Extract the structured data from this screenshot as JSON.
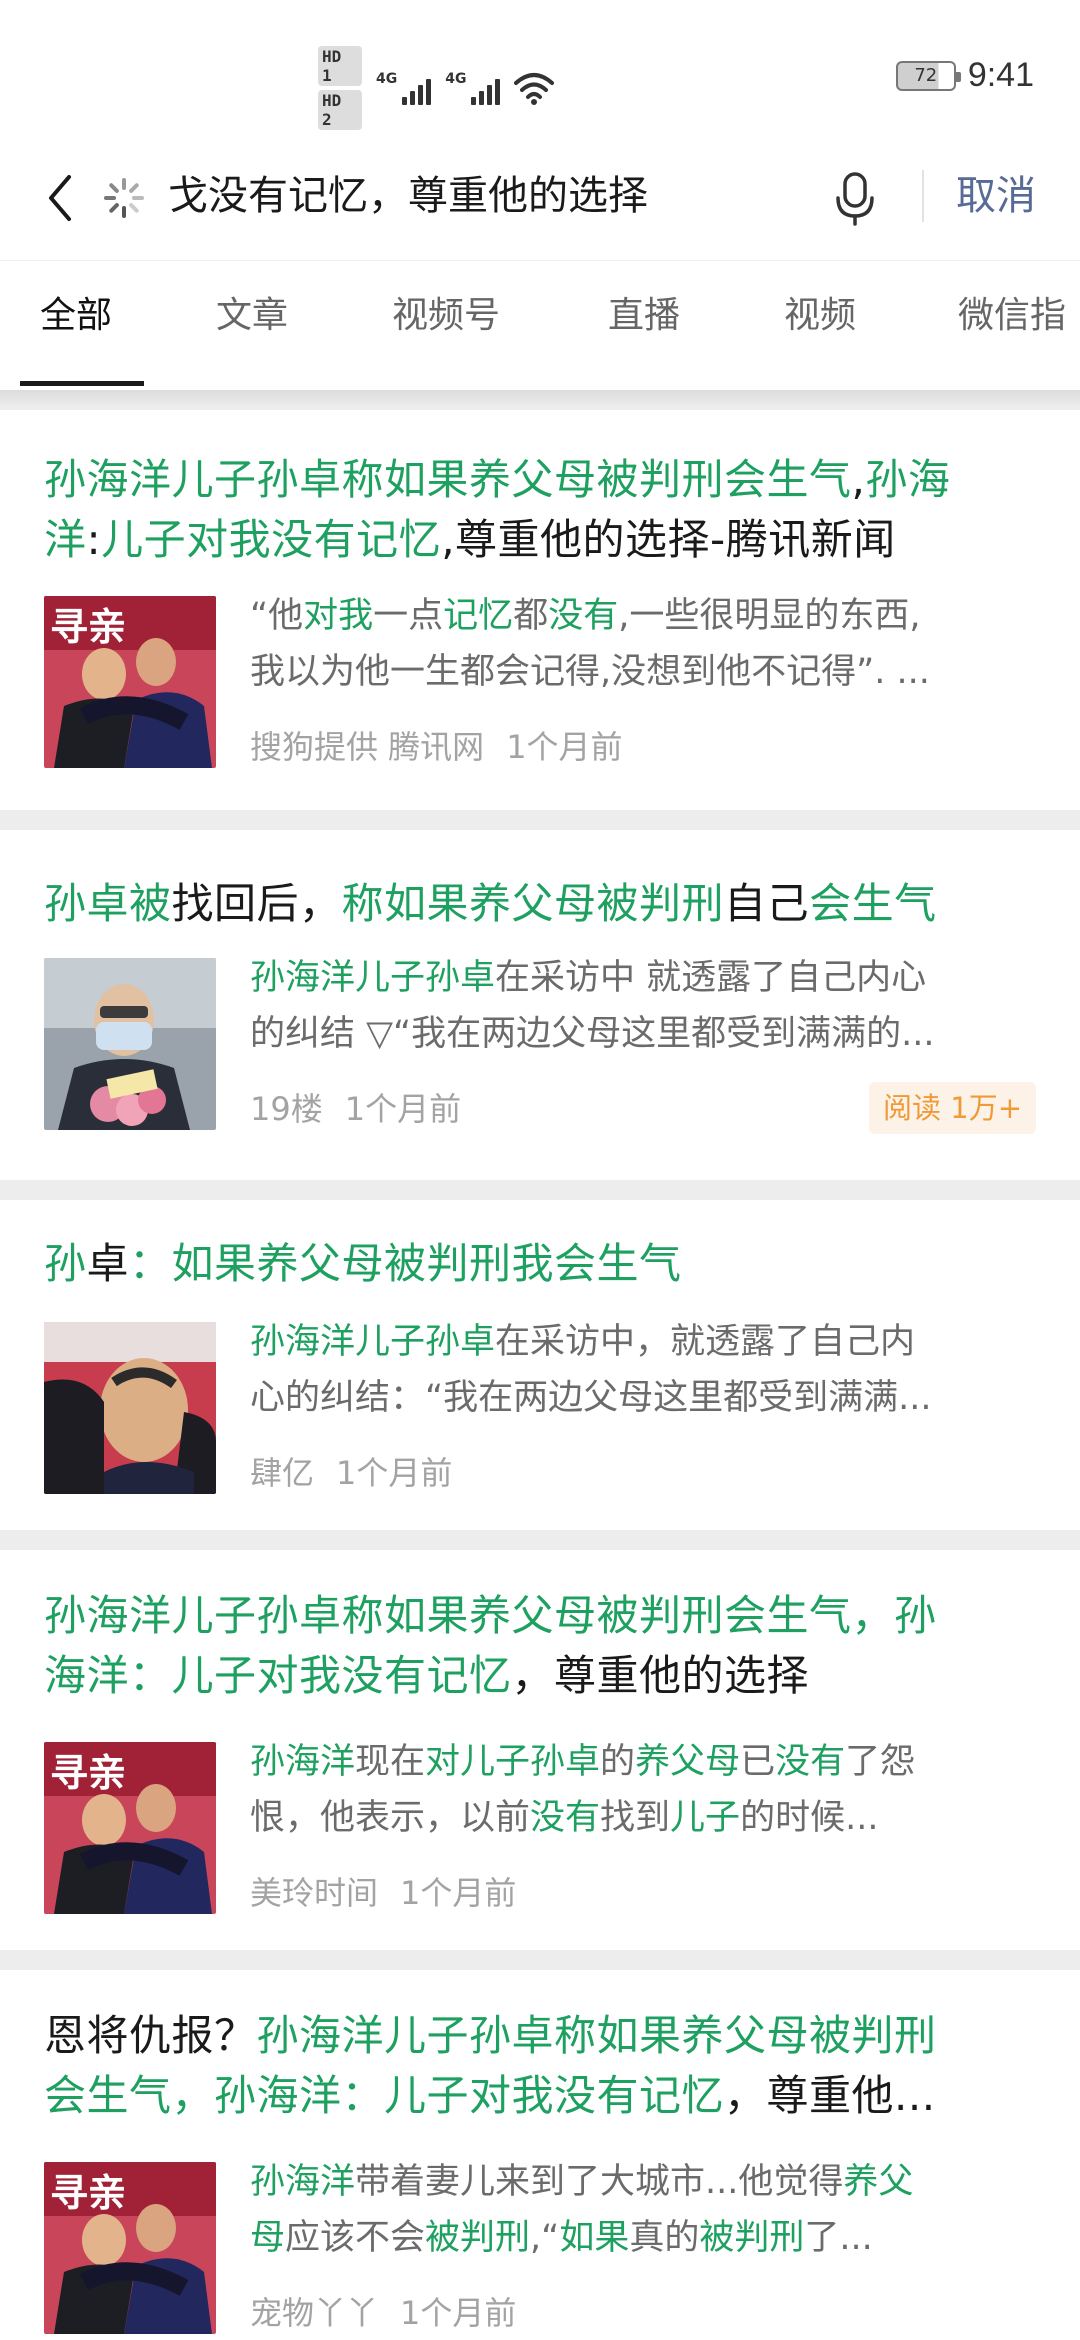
{
  "status_bar": {
    "sim1": "HD 1",
    "sim2": "HD 2",
    "net1": "4G",
    "net2": "4G",
    "battery": "72",
    "time": "9:41"
  },
  "search": {
    "query": "戈没有记忆，尊重他的选择",
    "cancel_label": "取消"
  },
  "tabs": [
    "全部",
    "文章",
    "视频号",
    "直播",
    "视频",
    "微信指"
  ],
  "results": [
    {
      "title_lines": [
        [
          {
            "t": "孙海洋儿子孙卓称如果养父母被判刑会生气",
            "hl": true
          },
          {
            "t": ",",
            "hl": false
          },
          {
            "t": "孙海",
            "hl": true
          }
        ],
        [
          {
            "t": "洋",
            "hl": true
          },
          {
            "t": ":",
            "hl": false
          },
          {
            "t": "儿子对我没有记忆",
            "hl": true
          },
          {
            "t": ",尊重他的选择-腾讯新闻",
            "hl": false
          }
        ]
      ],
      "snippet_lines": [
        [
          {
            "t": "“他",
            "hl": false
          },
          {
            "t": "对我",
            "hl": true
          },
          {
            "t": "一点",
            "hl": false
          },
          {
            "t": "记忆",
            "hl": true
          },
          {
            "t": "都",
            "hl": false
          },
          {
            "t": "没有",
            "hl": true
          },
          {
            "t": ",一些很明显的东西,",
            "hl": false
          }
        ],
        [
          {
            "t": "我以为他一生都会记得,没想到他不记得”. ...",
            "hl": false
          }
        ]
      ],
      "meta": [
        "搜狗提供 腾讯网",
        "1个月前"
      ],
      "badge": ""
    },
    {
      "title_lines": [
        [
          {
            "t": "孙卓被",
            "hl": true
          },
          {
            "t": "找回后，",
            "hl": false
          },
          {
            "t": "称如果养父母被判刑",
            "hl": true
          },
          {
            "t": "自己",
            "hl": false
          },
          {
            "t": "会生气",
            "hl": true
          }
        ]
      ],
      "snippet_lines": [
        [
          {
            "t": "孙海洋儿子孙卓",
            "hl": true
          },
          {
            "t": "在采访中 就透露了自己内心",
            "hl": false
          }
        ],
        [
          {
            "t": "的纠结 ▽“我在两边父母这里都受到满满的...",
            "hl": false
          }
        ]
      ],
      "meta": [
        "19楼",
        "1个月前"
      ],
      "badge": "阅读 1万+"
    },
    {
      "title_lines": [
        [
          {
            "t": "孙",
            "hl": true
          },
          {
            "t": "卓",
            "hl": false
          },
          {
            "t": "：如果养父母被判刑我会生气",
            "hl": true
          }
        ]
      ],
      "snippet_lines": [
        [
          {
            "t": "孙海洋儿子孙卓",
            "hl": true
          },
          {
            "t": "在采访中，就透露了自己内",
            "hl": false
          }
        ],
        [
          {
            "t": "心的纠结：“我在两边父母这里都受到满满...",
            "hl": false
          }
        ]
      ],
      "meta": [
        "肆亿",
        "1个月前"
      ],
      "badge": ""
    },
    {
      "title_lines": [
        [
          {
            "t": "孙海洋儿子孙卓称如果养父母被判刑会生气，孙",
            "hl": true
          }
        ],
        [
          {
            "t": "海洋：儿子对我没有记忆",
            "hl": true
          },
          {
            "t": "，尊重他的选择",
            "hl": false
          }
        ]
      ],
      "snippet_lines": [
        [
          {
            "t": "孙海洋",
            "hl": true
          },
          {
            "t": "现在",
            "hl": false
          },
          {
            "t": "对儿子孙卓",
            "hl": true
          },
          {
            "t": "的",
            "hl": false
          },
          {
            "t": "养父母",
            "hl": true
          },
          {
            "t": "已",
            "hl": false
          },
          {
            "t": "没有",
            "hl": true
          },
          {
            "t": "了怨",
            "hl": false
          }
        ],
        [
          {
            "t": "恨，他表示，以前",
            "hl": false
          },
          {
            "t": "没有",
            "hl": true
          },
          {
            "t": "找到",
            "hl": false
          },
          {
            "t": "儿子",
            "hl": true
          },
          {
            "t": "的时候...",
            "hl": false
          }
        ]
      ],
      "meta": [
        "美玲时间",
        "1个月前"
      ],
      "badge": ""
    },
    {
      "title_lines": [
        [
          {
            "t": "恩将仇报？",
            "hl": false
          },
          {
            "t": "孙海洋儿子孙卓称如果养父母被判刑",
            "hl": true
          }
        ],
        [
          {
            "t": "会生气，孙海洋：儿子对我没有记忆",
            "hl": true
          },
          {
            "t": "，尊重他...",
            "hl": false
          }
        ]
      ],
      "snippet_lines": [
        [
          {
            "t": "孙海洋",
            "hl": true
          },
          {
            "t": "带着妻儿来到了大城市...他觉得",
            "hl": false
          },
          {
            "t": "养父",
            "hl": true
          }
        ],
        [
          {
            "t": "母",
            "hl": true
          },
          {
            "t": "应该不会",
            "hl": false
          },
          {
            "t": "被判刑",
            "hl": true
          },
          {
            "t": ",“",
            "hl": false
          },
          {
            "t": "如果",
            "hl": true
          },
          {
            "t": "真的",
            "hl": false
          },
          {
            "t": "被判刑",
            "hl": true
          },
          {
            "t": "了...",
            "hl": false
          }
        ]
      ],
      "meta": [
        "宠物丫丫",
        "1个月前"
      ],
      "badge": ""
    }
  ],
  "thumb_images": [
    "photo-couple-hugging-son-red-backdrop",
    "photo-masked-young-man-with-flowers",
    "photo-man-crying-hug-closeup",
    "photo-couple-hugging-son-red-backdrop",
    "photo-couple-hugging-son-red-backdrop"
  ],
  "colors": {
    "highlight": "#1ea060",
    "link_blue": "#576b95",
    "badge_text": "#f09a37",
    "badge_bg": "#fdf2e7"
  }
}
